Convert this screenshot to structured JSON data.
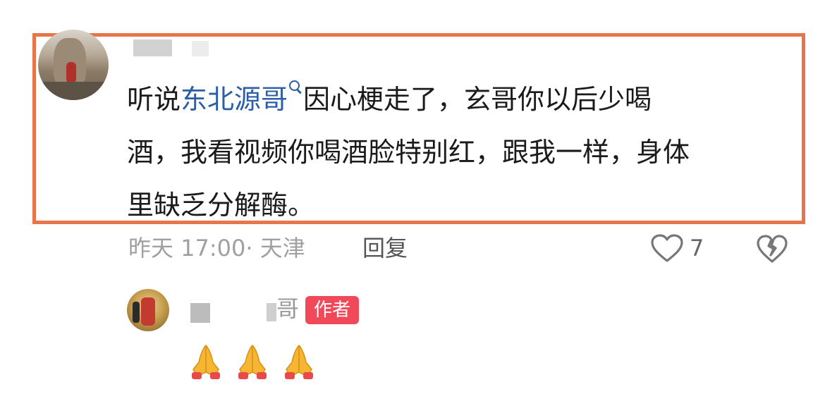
{
  "comment": {
    "segments": {
      "pre": "听说",
      "link": "东北源哥",
      "post_line1": "因心梗走了，玄哥你以后少喝",
      "line2": "酒，我看视频你喝酒脸特别红，跟我一样，身体",
      "line3": "里缺乏分解酶。"
    },
    "meta": "昨天 17:00· 天津",
    "reply_label": "回复",
    "like_count": "7"
  },
  "reply": {
    "name_tail": "哥",
    "badge": "作者",
    "content": "🙏🙏🙏"
  },
  "colors": {
    "highlight_border": "#e8744a",
    "link": "#2a5ea8",
    "author_badge": "#f04a5a"
  },
  "icons": [
    "search-icon",
    "heart-icon",
    "broken-heart-icon",
    "pray-emoji"
  ]
}
